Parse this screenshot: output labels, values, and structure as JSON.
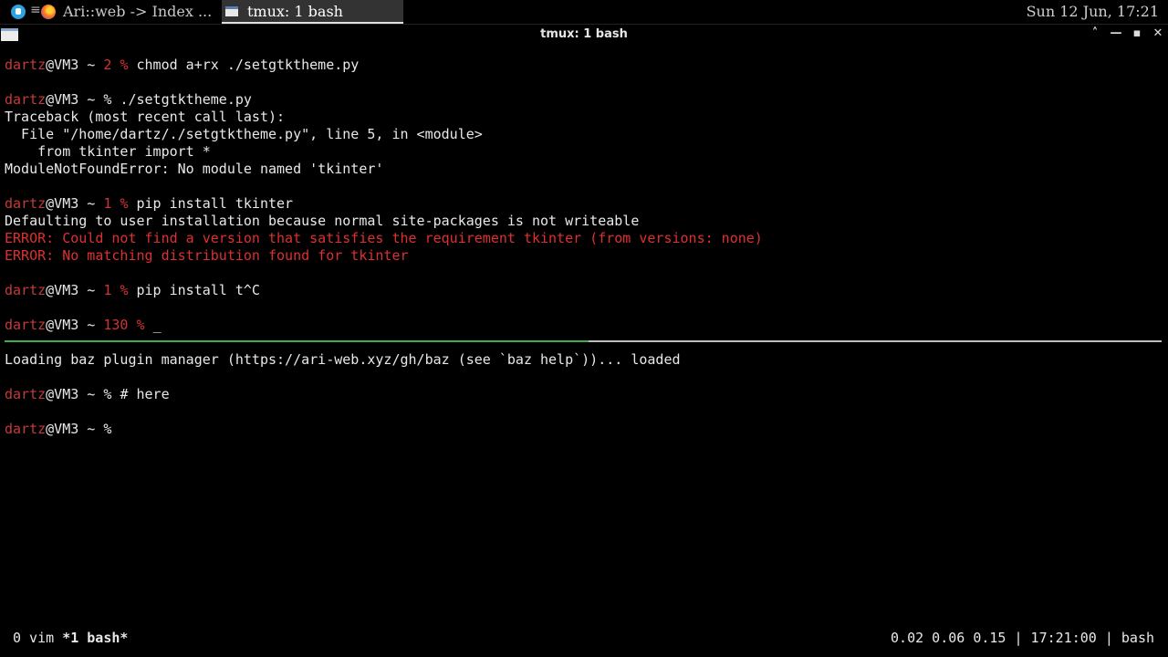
{
  "panel": {
    "menu_glyph": "≡",
    "tasks": [
      {
        "label": "Ari::web -> Index ...",
        "icon": "firefox-icon"
      },
      {
        "label": "tmux: 1 bash",
        "icon": "terminal-icon"
      }
    ],
    "clock": "Sun 12 Jun, 17:21"
  },
  "window": {
    "title": "tmux: 1 bash",
    "buttons": {
      "maximize_up": "˄",
      "minimize": "—",
      "restore": "▪",
      "close": "✕"
    }
  },
  "terminal": {
    "top_pane": [
      {
        "user": "dartz",
        "host": "@VM3 ~ ",
        "exit": "2 ",
        "prompt": "% ",
        "cmd": "chmod a+rx ./setgtktheme.py"
      },
      {
        "user": "dartz",
        "host": "@VM3 ~ ",
        "exit": "",
        "prompt": "% ",
        "cmd": "./setgtktheme.py"
      },
      {
        "text": "Traceback (most recent call last):"
      },
      {
        "text": "  File \"/home/dartz/./setgtktheme.py\", line 5, in <module>"
      },
      {
        "text": "    from tkinter import *"
      },
      {
        "text": "ModuleNotFoundError: No module named 'tkinter'"
      },
      {
        "user": "dartz",
        "host": "@VM3 ~ ",
        "exit": "1 ",
        "prompt": "% ",
        "cmd": "pip install tkinter"
      },
      {
        "text": "Defaulting to user installation because normal site-packages is not writeable"
      },
      {
        "error": "ERROR: Could not find a version that satisfies the requirement tkinter (from versions: none)"
      },
      {
        "error": "ERROR: No matching distribution found for tkinter"
      },
      {
        "user": "dartz",
        "host": "@VM3 ~ ",
        "exit": "1 ",
        "prompt": "% ",
        "cmd": "pip install t^C"
      },
      {
        "user": "dartz",
        "host": "@VM3 ~ ",
        "exit": "130 ",
        "prompt": "% ",
        "cmd": "_"
      }
    ],
    "bottom_pane": [
      {
        "text": "Loading baz plugin manager (https://ari-web.xyz/gh/baz (see `baz help`))... loaded"
      },
      {
        "user": "dartz",
        "host": "@VM3 ~ ",
        "exit": "",
        "prompt": "% ",
        "cmd": "# here"
      },
      {
        "user": "dartz",
        "host": "@VM3 ~ ",
        "exit": "",
        "prompt": "% ",
        "cmd": ""
      }
    ]
  },
  "statusbar": {
    "windows": [
      {
        "label": "0 vim",
        "active": false
      },
      {
        "label": "*1 bash*",
        "active": true
      }
    ],
    "right": "0.02 0.06 0.15 | 17:21:00 | bash"
  }
}
